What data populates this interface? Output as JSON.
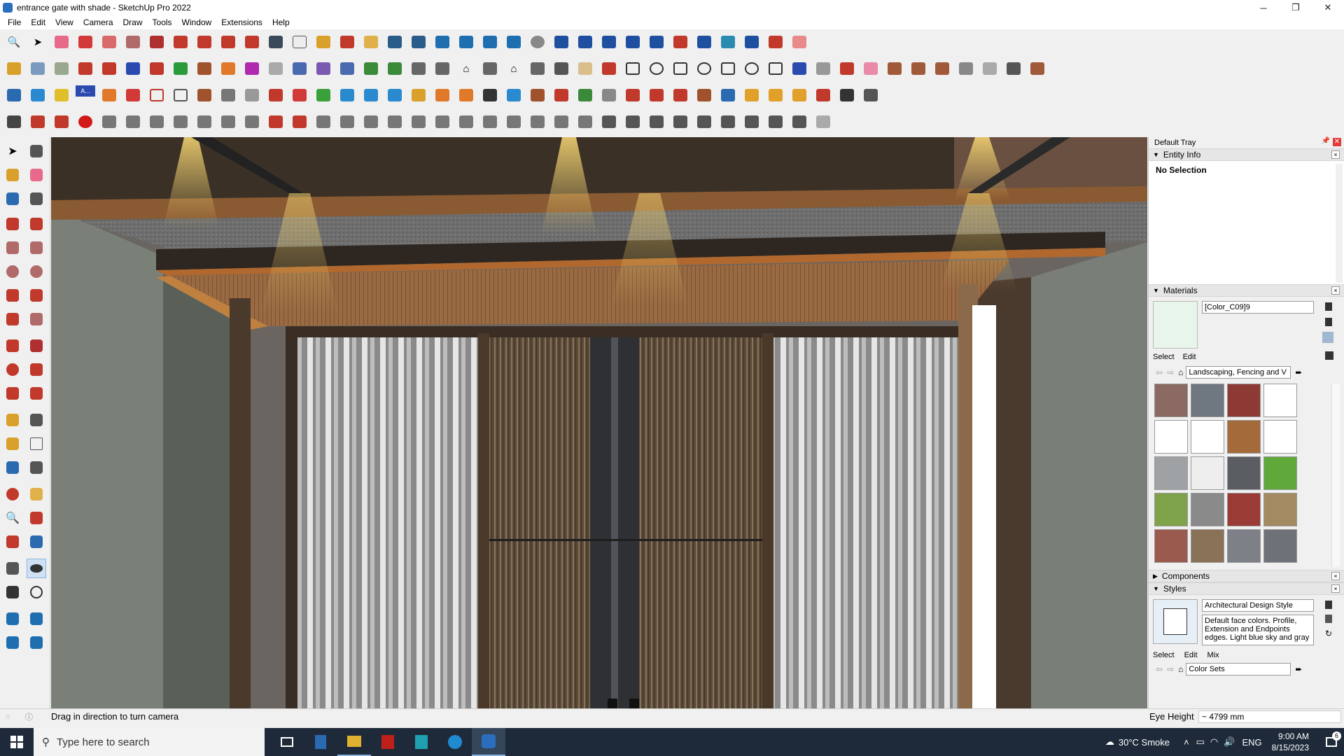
{
  "window": {
    "title": "entrance gate with shade - SketchUp Pro 2022",
    "minimize": "─",
    "restore": "❐",
    "close": "✕"
  },
  "menu": [
    "File",
    "Edit",
    "View",
    "Camera",
    "Draw",
    "Tools",
    "Window",
    "Extensions",
    "Help"
  ],
  "toolbar_badge": "A...",
  "tray": {
    "title": "Default Tray",
    "entity_info": {
      "header": "Entity Info",
      "status": "No Selection"
    },
    "materials": {
      "header": "Materials",
      "name_value": "[Color_C09]9",
      "tabs": [
        "Select",
        "Edit"
      ],
      "collection": "Landscaping, Fencing and V",
      "swatches": [
        "#8a6a62",
        "#6f7780",
        "#8e3a34",
        "#ffffff",
        "#ffffff",
        "#ffffff",
        "#a56a3a",
        "#ffffff",
        "#9ea2a4",
        "#eeeeee",
        "#5a5e62",
        "#5fa83a",
        "#7fa34a",
        "#8a8a8a",
        "#9a3b36",
        "#a48a62",
        "#9a5a4e",
        "#8a7258",
        "#7e8088",
        "#6e7278"
      ]
    },
    "components": {
      "header": "Components"
    },
    "styles": {
      "header": "Styles",
      "name_value": "Architectural Design Style",
      "description": "Default face colors. Profile, Extension and Endpoints edges. Light blue sky and gray",
      "tabs": [
        "Select",
        "Edit",
        "Mix"
      ],
      "collection": "Color Sets"
    }
  },
  "status": {
    "message": "Drag in direction to turn camera",
    "eye_height_label": "Eye Height",
    "eye_height_value": "~ 4799 mm"
  },
  "taskbar": {
    "search_placeholder": "Type here to search",
    "weather": "30°C  Smoke",
    "lang": "ENG",
    "time": "9:00 AM",
    "date": "8/15/2023",
    "notif_count": "6"
  },
  "colors": {
    "accent_red": "#e23b3b",
    "taskbar": "#1e2a3a",
    "wood": "#8a5a32"
  }
}
